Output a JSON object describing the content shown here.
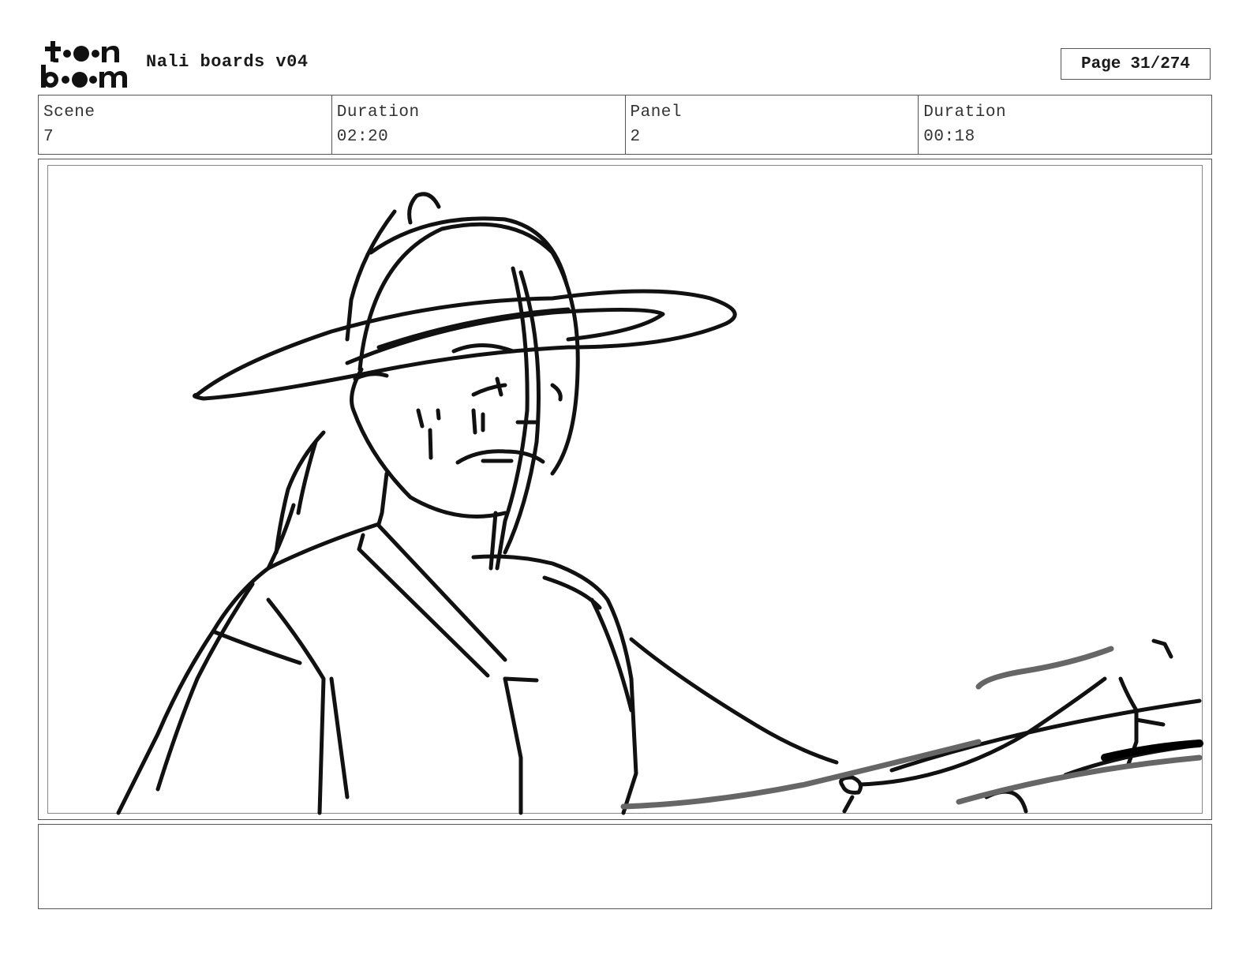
{
  "brand": {
    "logo_text_top": "toon",
    "logo_text_bottom": "boom",
    "logo_icon": "toon-boom-logo"
  },
  "header": {
    "title": "Nali boards v04",
    "page_label": "Page",
    "page_value": "31/274"
  },
  "info": {
    "scene_label": "Scene",
    "scene_value": "7",
    "scene_duration_label": "Duration",
    "scene_duration_value": "02:20",
    "panel_label": "Panel",
    "panel_value": "2",
    "panel_duration_label": "Duration",
    "panel_duration_value": "00:18"
  },
  "panel": {
    "image_icon": "storyboard-sketch-woman-with-hat"
  },
  "notes": {
    "text": ""
  }
}
